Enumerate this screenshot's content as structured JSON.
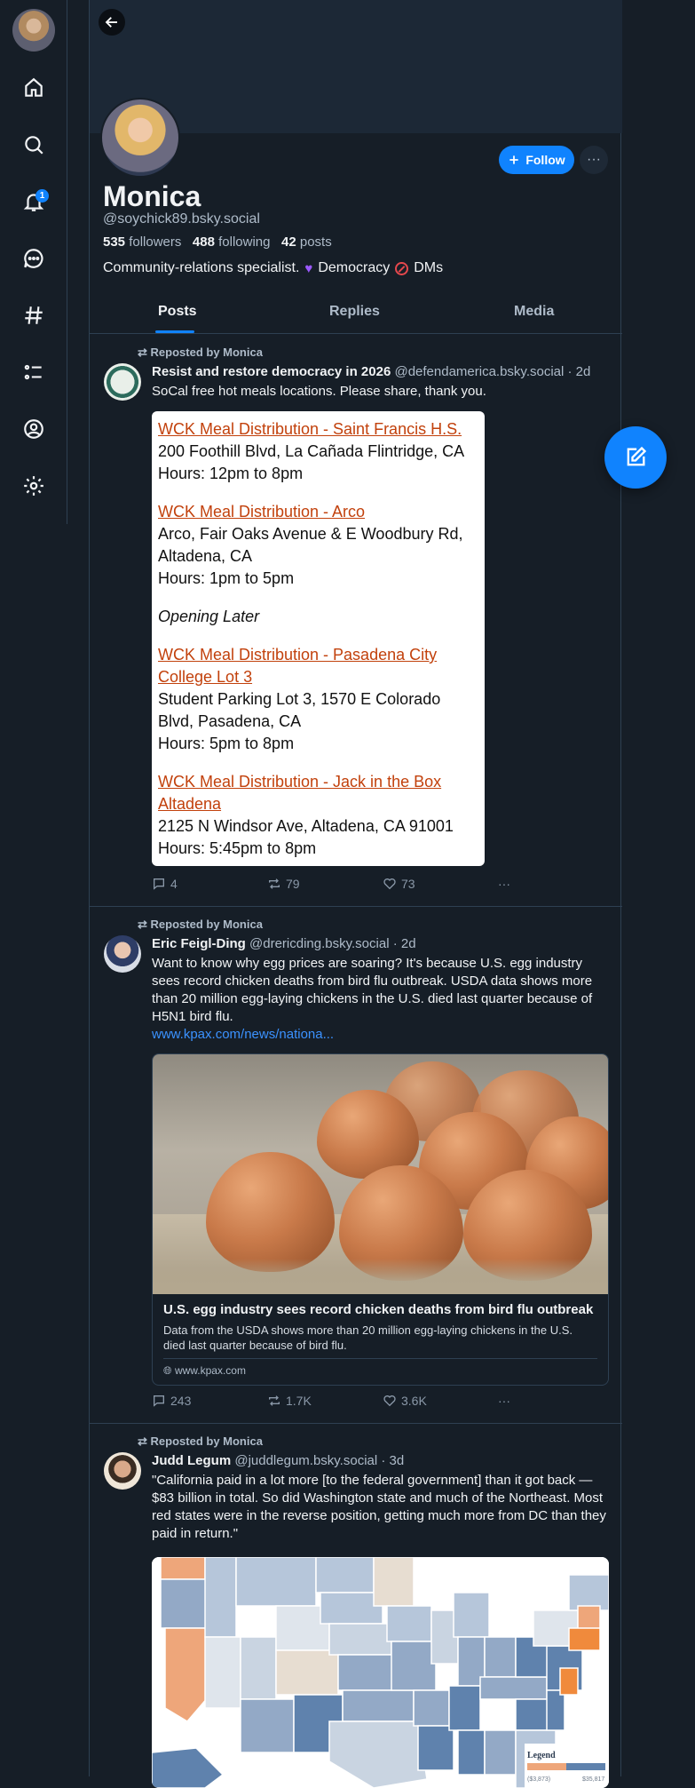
{
  "profile": {
    "display_name": "Monica",
    "handle": "@soychick89.bsky.social",
    "followers_count": "535",
    "followers_label": "followers",
    "following_count": "488",
    "following_label": "following",
    "posts_count": "42",
    "posts_label": "posts",
    "bio_text": "Community-relations specialist.",
    "bio_item1": "Democracy",
    "bio_item2": "DMs",
    "follow_label": "Follow",
    "more_label": "···"
  },
  "nav": {
    "notification_badge": "1"
  },
  "tabs": [
    {
      "label": "Posts"
    },
    {
      "label": "Replies"
    },
    {
      "label": "Media"
    }
  ],
  "posts": [
    {
      "repost_label": "Reposted by Monica",
      "author": "Resist and restore democracy in 2026",
      "handle": "@defendamerica.bsky.social",
      "time": "· 2d",
      "text": "SoCal free hot meals locations. Please share, thank you.",
      "embed": {
        "b1_link": "WCK Meal Distribution - Saint Francis H.S.",
        "b1_l1": "200 Foothill Blvd, La Cañada Flintridge, CA",
        "b1_l2": "Hours: 12pm to 8pm",
        "b2_link": "WCK Meal Distribution - Arco",
        "b2_l1": "Arco, Fair Oaks Avenue & E Woodbury Rd, Altadena, CA",
        "b2_l2": "Hours: 1pm to 5pm",
        "b3_italic": "Opening Later",
        "b4_link": "WCK Meal Distribution - Pasadena City College Lot 3",
        "b4_l1": "Student Parking Lot 3, 1570 E Colorado Blvd, Pasadena, CA",
        "b4_l2": "Hours: 5pm to 8pm",
        "b5_link": "WCK Meal Distribution - Jack in the Box Altadena",
        "b5_l1": "2125 N Windsor Ave, Altadena, CA 91001",
        "b5_l2": "Hours: 5:45pm to 8pm"
      },
      "replies": "4",
      "reposts": "79",
      "likes": "73",
      "more": "···"
    },
    {
      "repost_label": "Reposted by Monica",
      "author": "Eric Feigl-Ding",
      "handle": "@drericding.bsky.social",
      "time": "· 2d",
      "text": "Want to know why egg prices are soaring? It's because U.S. egg industry sees record chicken deaths from bird flu outbreak. USDA data shows more than 20 million egg-laying chickens in the U.S. died last quarter because of H5N1 bird flu.",
      "link": "www.kpax.com/news/nationa...",
      "card_title": "U.S. egg industry sees record chicken deaths from bird flu outbreak",
      "card_desc": "Data from the USDA shows more than 20 million egg-laying chickens in the U.S. died last quarter because of bird flu.",
      "card_domain": "www.kpax.com",
      "replies": "243",
      "reposts": "1.7K",
      "likes": "3.6K",
      "more": "···"
    },
    {
      "repost_label": "Reposted by Monica",
      "author": "Judd Legum",
      "handle": "@juddlegum.bsky.social",
      "time": "· 3d",
      "text": "\"California paid in a lot more [to the federal government] than it got back — $83 billion in total. So did Washington state and much of the Northeast. Most red states were in the reverse position, getting much more from DC than they paid in return.\"",
      "map_legend_title": "Legend",
      "map_legend_min": "($3,873)",
      "map_legend_max": "$35,817"
    }
  ],
  "colors": {
    "background": "#161e27",
    "accent": "#1083fe",
    "link": "#3b92ff",
    "muted": "#aebbc9",
    "border": "#2e4052",
    "wck_link": "#c2410c"
  },
  "icons": [
    "home-icon",
    "search-icon",
    "bell-icon",
    "chat-icon",
    "hashtag-icon",
    "list-icon",
    "profile-icon",
    "gear-icon",
    "back-arrow-icon",
    "plus-icon",
    "compose-icon",
    "reply-icon",
    "repost-icon",
    "heart-icon",
    "more-icon"
  ]
}
